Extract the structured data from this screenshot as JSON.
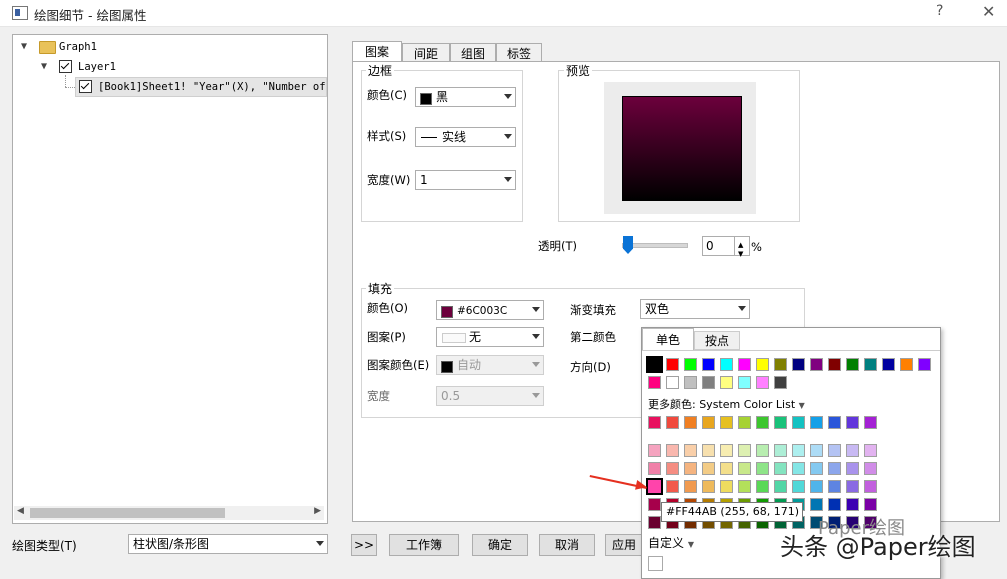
{
  "window": {
    "title": "绘图细节 - 绘图属性",
    "help": "?",
    "close": "✕"
  },
  "tree": {
    "graph": "Graph1",
    "layer": "Layer1",
    "plot": "[Book1]Sheet1! \"Year\"(X), \"Number of F"
  },
  "bottom": {
    "plot_type_label": "绘图类型(T)",
    "plot_type_value": "柱状图/条形图",
    "expand": ">>",
    "workbook": "工作簿",
    "ok": "确定",
    "cancel": "取消",
    "apply": "应用"
  },
  "tabs": [
    "图案",
    "间距",
    "组图",
    "标签"
  ],
  "border": {
    "group": "边框",
    "color_label": "颜色(C)",
    "color_value": "黑",
    "color_hex": "#000000",
    "style_label": "样式(S)",
    "style_value": "实线",
    "width_label": "宽度(W)",
    "width_value": "1"
  },
  "preview": {
    "group": "预览",
    "fill_top": "#6C003C",
    "fill_bottom": "#000000"
  },
  "transparency": {
    "label": "透明(T)",
    "value": "0",
    "unit": "%",
    "level": 0
  },
  "fill": {
    "group": "填充",
    "color_label": "颜色(O)",
    "color_value": "#6C003C",
    "pattern_label": "图案(P)",
    "pattern_value": "无",
    "pattern_color_label": "图案颜色(E)",
    "pattern_color_value": "自动",
    "width_label": "宽度",
    "width_value": "0.5",
    "gradient_label": "渐变填充",
    "gradient_value": "双色",
    "second_color_label": "第二颜色",
    "direction_label": "方向(D)"
  },
  "popup": {
    "tab_single": "单色",
    "tab_points": "按点",
    "more_colors": "更多颜色: System Color List",
    "custom": "自定义",
    "tooltip": "#FF44AB (255, 68, 171)",
    "basic_row1": [
      "#000000",
      "#FF0000",
      "#00FF00",
      "#0000FF",
      "#00FFFF",
      "#FF00FF",
      "#FFFF00",
      "#808000",
      "#000080",
      "#800080",
      "#800000",
      "#008000",
      "#008080",
      "#0000A0",
      "#FF8000",
      "#8000FF"
    ],
    "basic_row2": [
      "#FF0080",
      "#FFFFFF",
      "#C0C0C0",
      "#808080",
      "#FFFF80",
      "#80FFFF",
      "#FF80FF",
      "#404040"
    ],
    "system_rows": [
      [
        "#E8115F",
        "#F04A3E",
        "#F07F22",
        "#E8A61E",
        "#E6C020",
        "#A6D234",
        "#3DC62F",
        "#19C27A",
        "#13C2C2",
        "#14A0E8",
        "#2A56DA",
        "#6236DB",
        "#A421D4"
      ],
      [
        "#F5A3BF",
        "#F9B7AE",
        "#F9CFA9",
        "#F7E0AE",
        "#F7EDB1",
        "#DDF0B1",
        "#B8EEB0",
        "#ADEED6",
        "#ADEFEF",
        "#ADDCF6",
        "#B4C3F3",
        "#C8B9F3",
        "#E2B3F0"
      ],
      [
        "#F080A8",
        "#F58D82",
        "#F5B480",
        "#F3CC86",
        "#F3DF8B",
        "#C8E88A",
        "#8EE488",
        "#84E4C0",
        "#84E6E6",
        "#84C9F0",
        "#8CA6EC",
        "#A993EC",
        "#D18DE8"
      ],
      [
        "#FF44AB",
        "#F25A4B",
        "#F09A50",
        "#EEBA5C",
        "#EEDC5E",
        "#B3E05A",
        "#5AD856",
        "#52D6A6",
        "#50D8D8",
        "#50B4EA",
        "#5E84E2",
        "#8A6AE3",
        "#C260DE"
      ],
      [
        "#A6004B",
        "#B3002A",
        "#B34500",
        "#B37A00",
        "#B3A000",
        "#6B9A00",
        "#109A00",
        "#009A52",
        "#009A9A",
        "#0076B3",
        "#0030B3",
        "#3C00B3",
        "#7A00A6"
      ],
      [
        "#6A0030",
        "#73001A",
        "#732C00",
        "#734E00",
        "#736600",
        "#456300",
        "#0A6300",
        "#006335",
        "#006363",
        "#004C73",
        "#001F73",
        "#270073",
        "#4E006A"
      ]
    ]
  },
  "watermark": {
    "line1": "Paper绘图",
    "line2": "头条 @Paper绘图"
  }
}
